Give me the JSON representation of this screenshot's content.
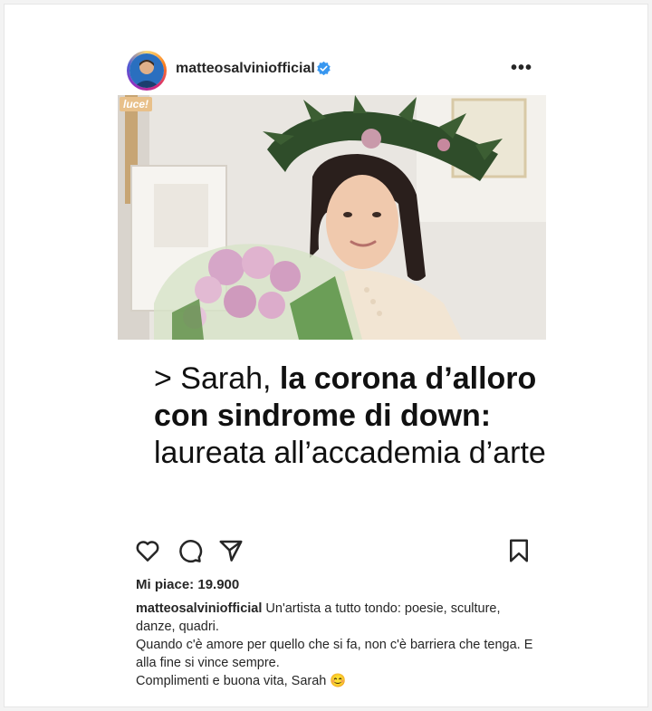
{
  "post": {
    "username": "matteosalviniofficial",
    "more_label": "•••",
    "image_badge": "luce!",
    "headline": {
      "prefix": "> Sarah, ",
      "bold1": "la corona d’alloro con sindrome di down:",
      "normal2": " laureata all’accademia d’arte"
    },
    "likes_label": "Mi piace: 19.900",
    "caption": {
      "user": "matteosalviniofficial",
      "line1": " Un'artista a tutto tondo: poesie, sculture, danze, quadri.",
      "line2": "Quando c'è amore per quello che si fa, non c'è barriera che tenga. E alla fine si vince sempre.",
      "line3": "Complimenti e buona vita, Sarah 😊"
    }
  },
  "icons": {
    "verified": "verified-badge-icon",
    "like": "heart-icon",
    "comment": "comment-icon",
    "share": "paper-plane-icon",
    "save": "bookmark-icon",
    "more": "more-options-icon"
  },
  "colors": {
    "verified_blue": "#3897f0",
    "text": "#262626",
    "headline_text": "#111111"
  }
}
